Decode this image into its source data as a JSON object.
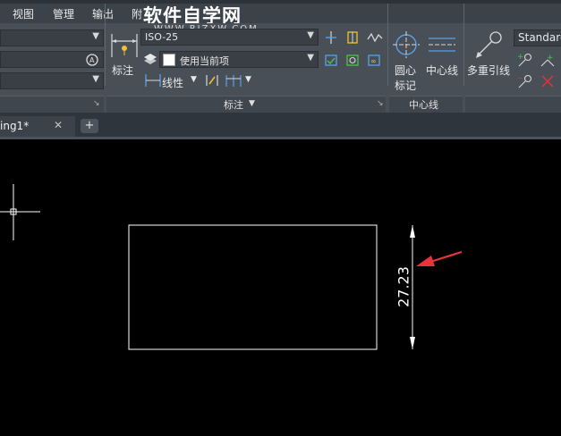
{
  "menubar": {
    "items": [
      "视图",
      "管理",
      "输出",
      "附"
    ],
    "watermark": "软件自学网",
    "watermark_url": "WWW.RJZXW.COM"
  },
  "dimension_panel": {
    "dim_button_label": "标注",
    "dim_style": "ISO-25",
    "layer_value": "使用当前项",
    "linear_label": "线性",
    "title": "标注"
  },
  "centerline_panel": {
    "center_mark_label_line1": "圆心",
    "center_mark_label_line2": "标记",
    "centerline_label": "中心线",
    "title": "中心线"
  },
  "leader_panel": {
    "multileader_label": "多重引线",
    "style_value": "Standard"
  },
  "tabs": {
    "active_label": "ing1*",
    "close_glyph": "✕",
    "add_glyph": "+"
  },
  "drawing": {
    "dimension_text": "27.23"
  },
  "colors": {
    "ribbon_bg": "#484f57",
    "menubar_bg": "#3c4249",
    "canvas_bg": "#000000",
    "annotation_arrow": "#e8333a",
    "accent_blue": "#5aa0e6"
  }
}
